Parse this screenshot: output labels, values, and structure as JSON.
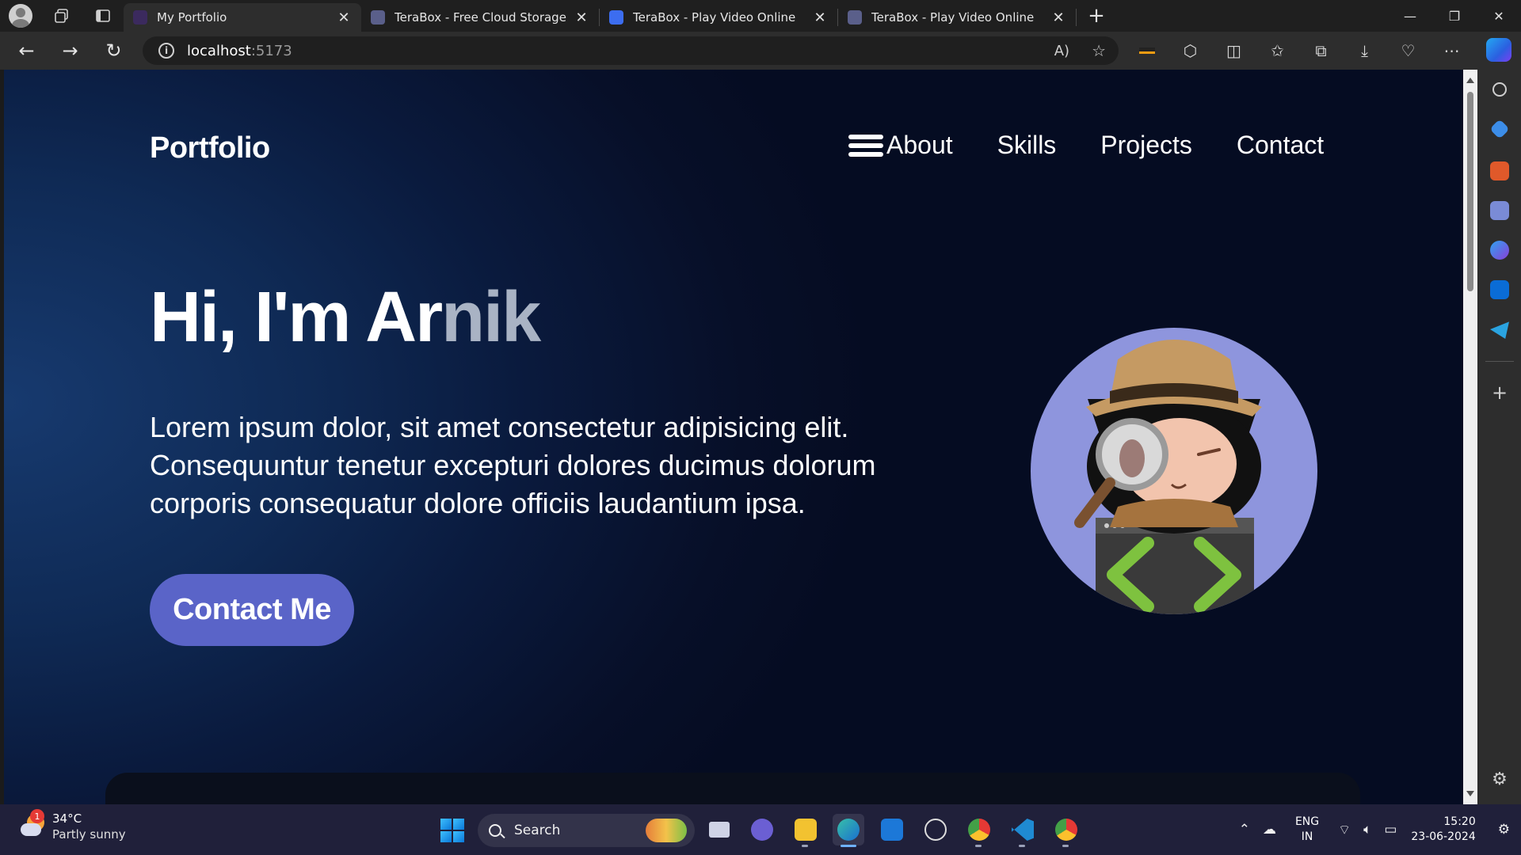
{
  "browser": {
    "tabs": [
      {
        "title": "My Portfolio",
        "active": true,
        "favicon_color": "#3b2a5e"
      },
      {
        "title": "TeraBox - Free Cloud Storage Up",
        "active": false,
        "favicon_color": "#5a5f8a"
      },
      {
        "title": "TeraBox - Play Video Online",
        "active": false,
        "favicon_color": "#3c6df0"
      },
      {
        "title": "TeraBox - Play Video Online",
        "active": false,
        "favicon_color": "#5a5f8a"
      }
    ],
    "url_host": "localhost",
    "url_port": ":5173"
  },
  "page": {
    "brand": "Portfolio",
    "nav": [
      "About",
      "Skills",
      "Projects",
      "Contact"
    ],
    "hero_title_main": "Hi, I'm Ar",
    "hero_title_faded": "nik",
    "hero_description": "Lorem ipsum dolor, sit amet consectetur adipisicing elit. Consequuntur tenetur excepturi dolores ducimus dolorum corporis consequatur dolore officiis laudantium ipsa.",
    "cta_label": "Contact Me",
    "colors": {
      "accent": "#5a64c8",
      "background": "#0a1a3d",
      "faded_text": "#a9b3c4"
    }
  },
  "taskbar": {
    "weather_temp": "34°C",
    "weather_condition": "Partly sunny",
    "weather_badge": "1",
    "search_label": "Search",
    "lang_1": "ENG",
    "lang_2": "IN",
    "time": "15:20",
    "date": "23-06-2024"
  }
}
